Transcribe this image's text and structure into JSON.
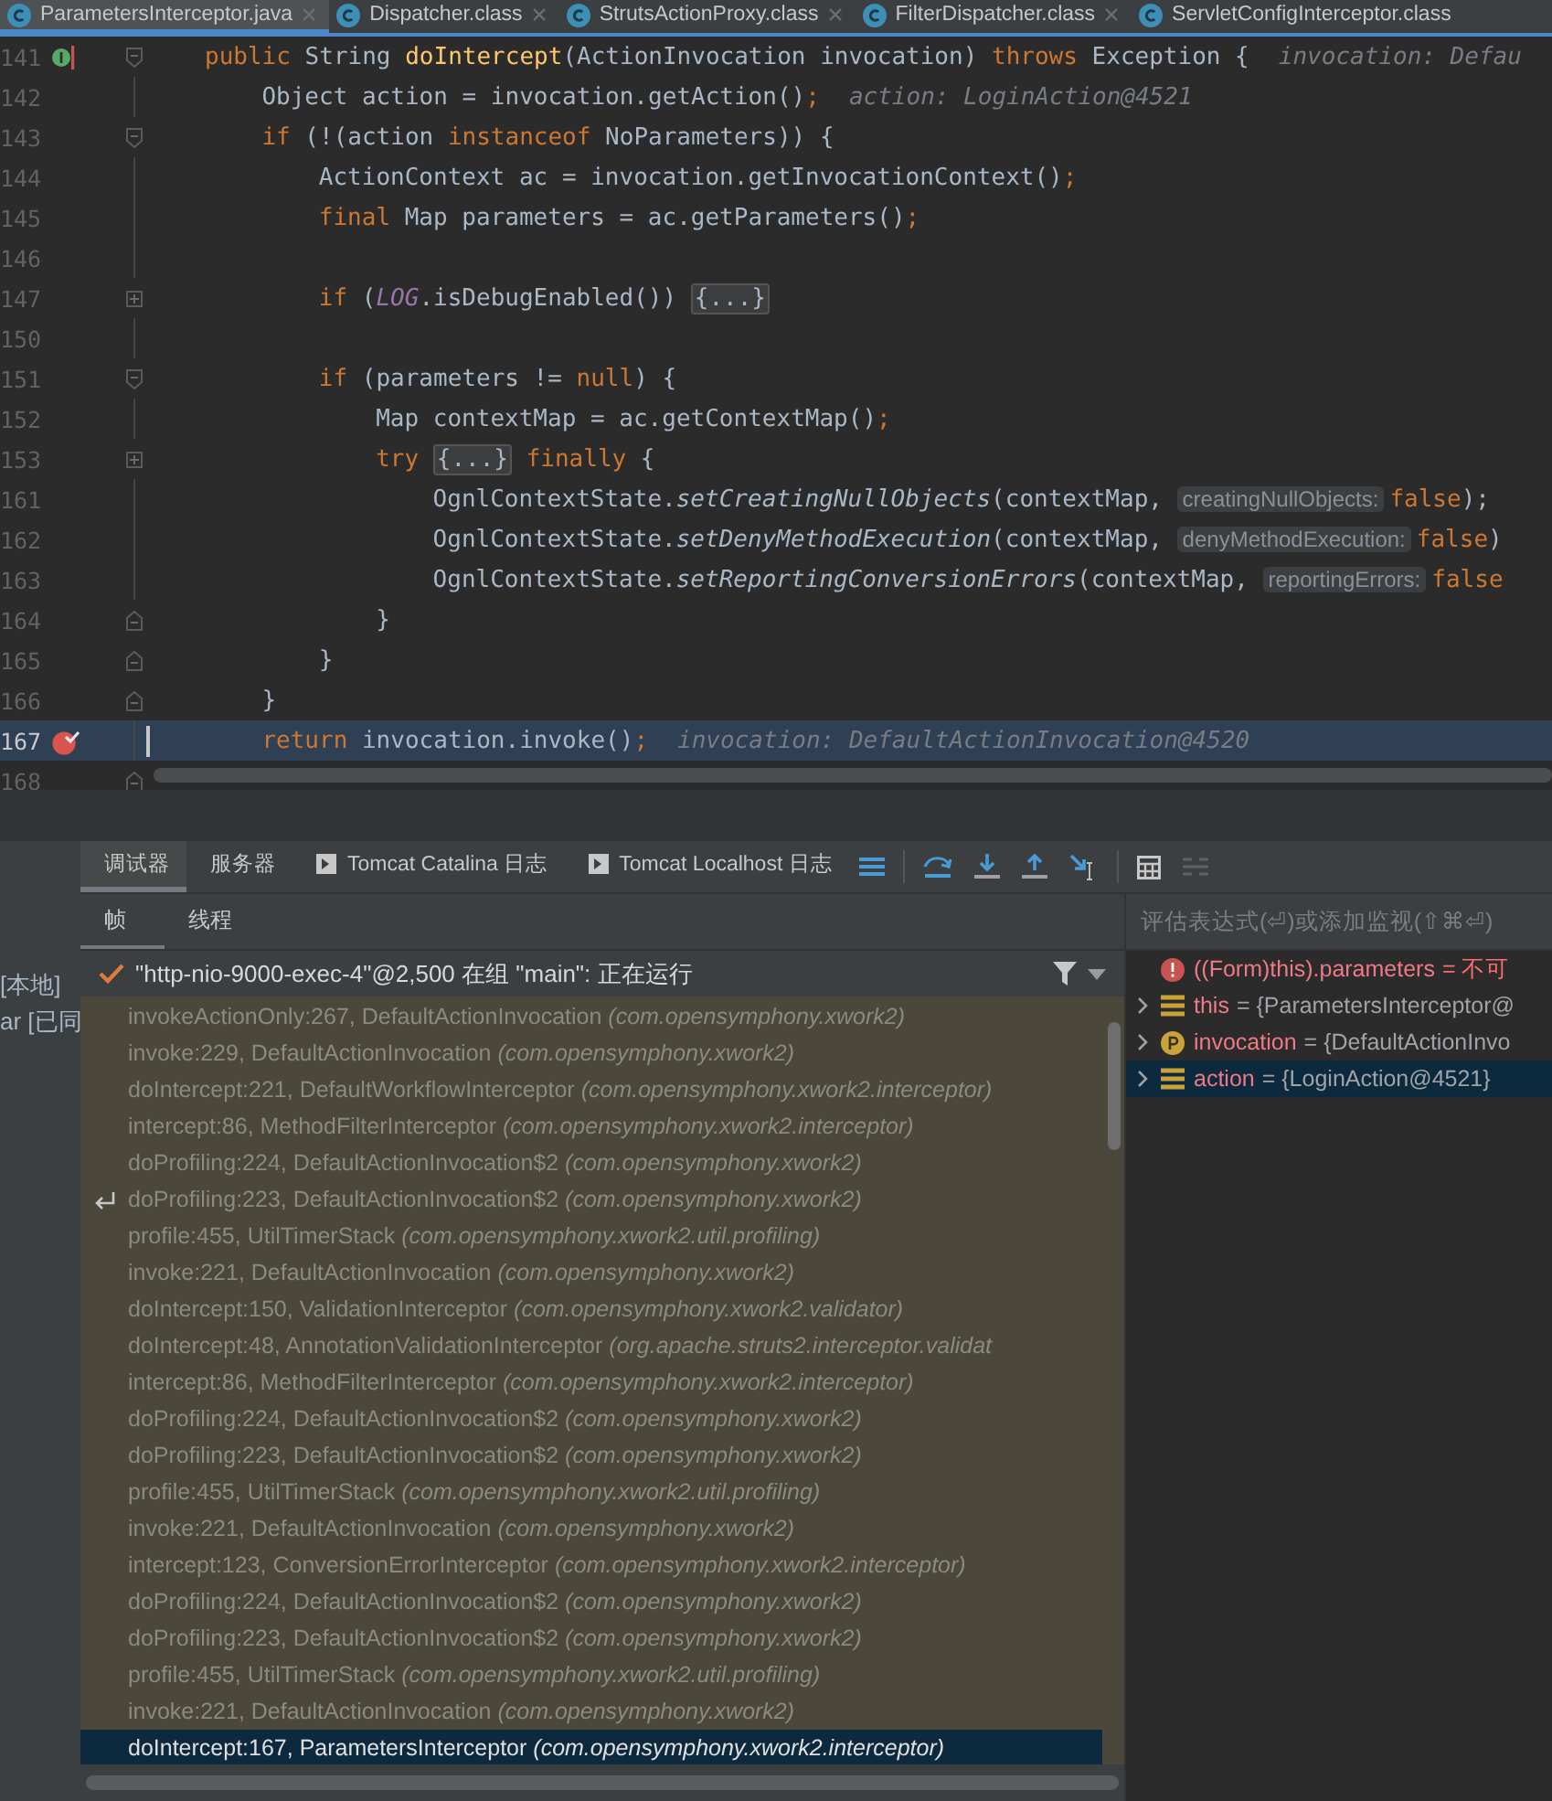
{
  "editor_tabs": [
    {
      "label": "ParametersInterceptor.java",
      "selected": true,
      "closable": true
    },
    {
      "label": "Dispatcher.class",
      "selected": false,
      "closable": true
    },
    {
      "label": "StrutsActionProxy.class",
      "selected": false,
      "closable": true
    },
    {
      "label": "FilterDispatcher.class",
      "selected": false,
      "closable": true
    },
    {
      "label": "ServletConfigInterceptor.class",
      "selected": false,
      "closable": false
    }
  ],
  "code_lines": [
    {
      "number": "141",
      "kind": "fold-start",
      "selected": false,
      "override": true,
      "breakpoint": false,
      "tokens": [
        {
          "kind": "kw",
          "text": "public"
        },
        {
          "kind": "p",
          "text": " String "
        },
        {
          "kind": "fn",
          "text": "doIntercept"
        },
        {
          "kind": "p",
          "text": "(ActionInvocation invocation) "
        },
        {
          "kind": "kw",
          "text": "throws"
        },
        {
          "kind": "p",
          "text": " Exception {"
        },
        {
          "kind": "dbg",
          "text": "invocation: Defau"
        }
      ],
      "children": [
        {
          "number": "142",
          "kind": "plain",
          "selected": false,
          "override": false,
          "breakpoint": false,
          "tokens": [
            {
              "kind": "p",
              "text": "Object action = invocation.getAction()"
            },
            {
              "kind": "kw",
              "text": ";"
            },
            {
              "kind": "dbg",
              "text": "action: LoginAction@4521"
            }
          ]
        },
        {
          "number": "143",
          "kind": "fold-start",
          "selected": false,
          "override": false,
          "breakpoint": false,
          "tokens": [
            {
              "kind": "kw",
              "text": "if"
            },
            {
              "kind": "p",
              "text": " (!(action "
            },
            {
              "kind": "kw",
              "text": "instanceof"
            },
            {
              "kind": "p",
              "text": " NoParameters)) {"
            }
          ],
          "children": [
            {
              "number": "144",
              "kind": "plain",
              "selected": false,
              "override": false,
              "breakpoint": false,
              "tokens": [
                {
                  "kind": "p",
                  "text": "ActionContext ac = invocation.getInvocationContext()"
                },
                {
                  "kind": "kw",
                  "text": ";"
                }
              ]
            },
            {
              "number": "145",
              "kind": "plain",
              "selected": false,
              "override": false,
              "breakpoint": false,
              "tokens": [
                {
                  "kind": "kw",
                  "text": "final"
                },
                {
                  "kind": "p",
                  "text": " Map parameters = ac.getParameters()"
                },
                {
                  "kind": "kw",
                  "text": ";"
                }
              ]
            },
            {
              "number": "146",
              "kind": "plain",
              "selected": false,
              "override": false,
              "breakpoint": false
            },
            {
              "number": "147",
              "kind": "folded",
              "selected": false,
              "override": false,
              "breakpoint": false,
              "tokens": [
                {
                  "kind": "kw",
                  "text": "if"
                },
                {
                  "kind": "p",
                  "text": " ("
                },
                {
                  "kind": "field",
                  "text": "LOG"
                },
                {
                  "kind": "p",
                  "text": ".isDebugEnabled())"
                },
                {
                  "kind": "folded",
                  "text": "{...}"
                }
              ]
            },
            {
              "number": "150",
              "kind": "plain",
              "selected": false,
              "override": false,
              "breakpoint": false
            },
            {
              "number": "151",
              "kind": "fold-start",
              "selected": false,
              "override": false,
              "breakpoint": false,
              "tokens": [
                {
                  "kind": "kw",
                  "text": "if"
                },
                {
                  "kind": "p",
                  "text": " (parameters != "
                },
                {
                  "kind": "kw",
                  "text": "null"
                },
                {
                  "kind": "p",
                  "text": ") {"
                }
              ],
              "children": [
                {
                  "number": "152",
                  "kind": "plain",
                  "selected": false,
                  "override": false,
                  "breakpoint": false,
                  "tokens": [
                    {
                      "kind": "p",
                      "text": "Map contextMap = ac.getContextMap()"
                    },
                    {
                      "kind": "kw",
                      "text": ";"
                    }
                  ]
                },
                {
                  "number": "153",
                  "kind": "folded",
                  "selected": false,
                  "override": false,
                  "breakpoint": false,
                  "tokens": [
                    {
                      "kind": "kw",
                      "text": "try"
                    },
                    {
                      "kind": "folded",
                      "text": "{...}"
                    },
                    {
                      "kind": "kw",
                      "text": "finally"
                    },
                    {
                      "kind": "p",
                      "text": " {"
                    }
                  ],
                  "children": [
                    {
                      "number": "161",
                      "kind": "plain",
                      "selected": false,
                      "override": false,
                      "breakpoint": false,
                      "tokens": [
                        {
                          "kind": "p",
                          "text": "OgnlContextState."
                        },
                        {
                          "kind": "static",
                          "text": "setCreatingNullObjects"
                        },
                        {
                          "kind": "p",
                          "text": "(contextMap, "
                        },
                        {
                          "kind": "hint",
                          "text": "creatingNullObjects:"
                        },
                        {
                          "kind": "kw",
                          "text": "false"
                        },
                        {
                          "kind": "p",
                          "text": ");"
                        }
                      ]
                    },
                    {
                      "number": "162",
                      "kind": "plain",
                      "selected": false,
                      "override": false,
                      "breakpoint": false,
                      "tokens": [
                        {
                          "kind": "p",
                          "text": "OgnlContextState."
                        },
                        {
                          "kind": "static",
                          "text": "setDenyMethodExecution"
                        },
                        {
                          "kind": "p",
                          "text": "(contextMap, "
                        },
                        {
                          "kind": "hint",
                          "text": "denyMethodExecution:"
                        },
                        {
                          "kind": "kw",
                          "text": "false"
                        },
                        {
                          "kind": "p",
                          "text": ")"
                        }
                      ]
                    },
                    {
                      "number": "163",
                      "kind": "plain",
                      "selected": false,
                      "override": false,
                      "breakpoint": false,
                      "tokens": [
                        {
                          "kind": "p",
                          "text": "OgnlContextState."
                        },
                        {
                          "kind": "static",
                          "text": "setReportingConversionErrors"
                        },
                        {
                          "kind": "p",
                          "text": "(contextMap, "
                        },
                        {
                          "kind": "hint",
                          "text": "reportingErrors:"
                        },
                        {
                          "kind": "kw",
                          "text": "false"
                        }
                      ]
                    }
                  ]
                },
                {
                  "number": "164",
                  "kind": "fold-end",
                  "selected": false,
                  "override": false,
                  "breakpoint": false,
                  "tokens": [
                    {
                      "kind": "p",
                      "text": "}"
                    }
                  ]
                }
              ]
            },
            {
              "number": "165",
              "kind": "fold-end",
              "selected": false,
              "override": false,
              "breakpoint": false,
              "tokens": [
                {
                  "kind": "p",
                  "text": "}"
                }
              ]
            }
          ]
        },
        {
          "number": "166",
          "kind": "fold-end",
          "selected": false,
          "override": false,
          "breakpoint": false,
          "tokens": [
            {
              "kind": "p",
              "text": "}"
            }
          ]
        },
        {
          "number": "167",
          "kind": "plain",
          "selected": true,
          "override": false,
          "breakpoint": true,
          "tokens": [
            {
              "kind": "kw",
              "text": "return"
            },
            {
              "kind": "p",
              "text": " invocation.invoke()"
            },
            {
              "kind": "kw",
              "text": ";"
            },
            {
              "kind": "dbg",
              "text": "invocation: DefaultActionInvocation@4520"
            }
          ]
        },
        {
          "number": "168",
          "kind": "fold-end",
          "selected": false,
          "override": false,
          "breakpoint": false
        }
      ]
    }
  ],
  "side_labels": [
    "[本地]",
    "ar [已同"
  ],
  "tool_tabs": [
    {
      "label": "调试器",
      "selected": true,
      "console": false
    },
    {
      "label": "服务器",
      "selected": false,
      "console": false
    },
    {
      "label": "Tomcat Catalina 日志",
      "selected": false,
      "console": true
    },
    {
      "label": "Tomcat Localhost 日志",
      "selected": false,
      "console": true
    }
  ],
  "sub_tabs": [
    {
      "label": "帧",
      "selected": true
    },
    {
      "label": "线程",
      "selected": false
    }
  ],
  "thread": "\"http-nio-9000-exec-4\"@2,500 在组 \"main\": 正在运行",
  "frames": [
    {
      "method": "invokeActionOnly:267, DefaultActionInvocation",
      "package": "(com.opensymphony.xwork2)",
      "selected": false,
      "marked": false
    },
    {
      "method": "invoke:229, DefaultActionInvocation",
      "package": "(com.opensymphony.xwork2)",
      "selected": false,
      "marked": false
    },
    {
      "method": "doIntercept:221, DefaultWorkflowInterceptor",
      "package": "(com.opensymphony.xwork2.interceptor)",
      "selected": false,
      "marked": false
    },
    {
      "method": "intercept:86, MethodFilterInterceptor",
      "package": "(com.opensymphony.xwork2.interceptor)",
      "selected": false,
      "marked": false
    },
    {
      "method": "doProfiling:224, DefaultActionInvocation$2",
      "package": "(com.opensymphony.xwork2)",
      "selected": false,
      "marked": false
    },
    {
      "method": "doProfiling:223, DefaultActionInvocation$2",
      "package": "(com.opensymphony.xwork2)",
      "selected": false,
      "marked": true
    },
    {
      "method": "profile:455, UtilTimerStack",
      "package": "(com.opensymphony.xwork2.util.profiling)",
      "selected": false,
      "marked": false
    },
    {
      "method": "invoke:221, DefaultActionInvocation",
      "package": "(com.opensymphony.xwork2)",
      "selected": false,
      "marked": false
    },
    {
      "method": "doIntercept:150, ValidationInterceptor",
      "package": "(com.opensymphony.xwork2.validator)",
      "selected": false,
      "marked": false
    },
    {
      "method": "doIntercept:48, AnnotationValidationInterceptor",
      "package": "(org.apache.struts2.interceptor.validat",
      "selected": false,
      "marked": false
    },
    {
      "method": "intercept:86, MethodFilterInterceptor",
      "package": "(com.opensymphony.xwork2.interceptor)",
      "selected": false,
      "marked": false
    },
    {
      "method": "doProfiling:224, DefaultActionInvocation$2",
      "package": "(com.opensymphony.xwork2)",
      "selected": false,
      "marked": false
    },
    {
      "method": "doProfiling:223, DefaultActionInvocation$2",
      "package": "(com.opensymphony.xwork2)",
      "selected": false,
      "marked": false
    },
    {
      "method": "profile:455, UtilTimerStack",
      "package": "(com.opensymphony.xwork2.util.profiling)",
      "selected": false,
      "marked": false
    },
    {
      "method": "invoke:221, DefaultActionInvocation",
      "package": "(com.opensymphony.xwork2)",
      "selected": false,
      "marked": false
    },
    {
      "method": "intercept:123, ConversionErrorInterceptor",
      "package": "(com.opensymphony.xwork2.interceptor)",
      "selected": false,
      "marked": false
    },
    {
      "method": "doProfiling:224, DefaultActionInvocation$2",
      "package": "(com.opensymphony.xwork2)",
      "selected": false,
      "marked": false
    },
    {
      "method": "doProfiling:223, DefaultActionInvocation$2",
      "package": "(com.opensymphony.xwork2)",
      "selected": false,
      "marked": false
    },
    {
      "method": "profile:455, UtilTimerStack",
      "package": "(com.opensymphony.xwork2.util.profiling)",
      "selected": false,
      "marked": false
    },
    {
      "method": "invoke:221, DefaultActionInvocation",
      "package": "(com.opensymphony.xwork2)",
      "selected": false,
      "marked": false
    },
    {
      "method": "doIntercept:167, ParametersInterceptor",
      "package": "(com.opensymphony.xwork2.interceptor)",
      "selected": true,
      "marked": false
    }
  ],
  "watch_field": {
    "placeholder": "评估表达式(⏎)或添加监视(⇧⌘⏎)"
  },
  "variables": [
    {
      "kind": "error",
      "name": "((Form)this).parameters",
      "value": "= 不可",
      "expandable": false,
      "selected": false
    },
    {
      "kind": "field",
      "name": "this",
      "value": "= {ParametersInterceptor@",
      "expandable": true,
      "selected": false
    },
    {
      "kind": "param",
      "name": "invocation",
      "value": "= {DefaultActionInvo",
      "expandable": true,
      "selected": false
    },
    {
      "kind": "field",
      "name": "action",
      "value": "= {LoginAction@4521}",
      "expandable": true,
      "selected": true
    }
  ]
}
